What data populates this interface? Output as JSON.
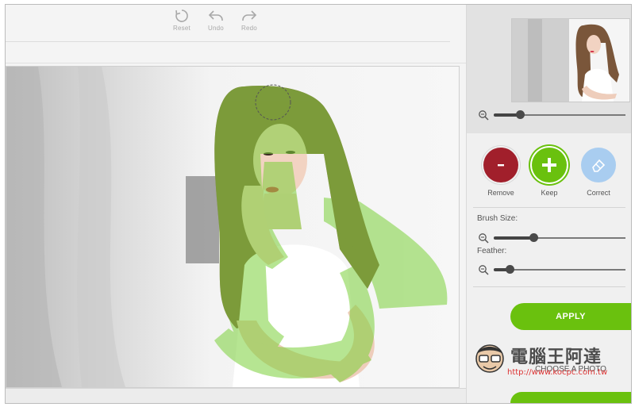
{
  "toolbar": {
    "reset_label": "Reset",
    "undo_label": "Undo",
    "redo_label": "Redo"
  },
  "panel": {
    "modes": [
      {
        "label": "Remove",
        "icon": "minus-icon",
        "color": "#a11f2b"
      },
      {
        "label": "Keep",
        "icon": "plus-icon",
        "color": "#6ac10e"
      },
      {
        "label": "Correct",
        "icon": "eraser-icon",
        "color": "#a9cdf0"
      }
    ],
    "brush_size_label": "Brush Size:",
    "feather_label": "Feather:",
    "zoom_level": 0.2,
    "brush_size_level": 0.3,
    "feather_level": 0.12,
    "apply_label": "APPLY",
    "choose_label": "CHOOSE A PHOTO"
  },
  "watermark": {
    "text": "電腦王阿達",
    "url": "http://www.kocpc.com.tw"
  },
  "colors": {
    "accent_green": "#6ac10e",
    "remove_red": "#a11f2b",
    "correct_blue": "#a9cdf0"
  }
}
